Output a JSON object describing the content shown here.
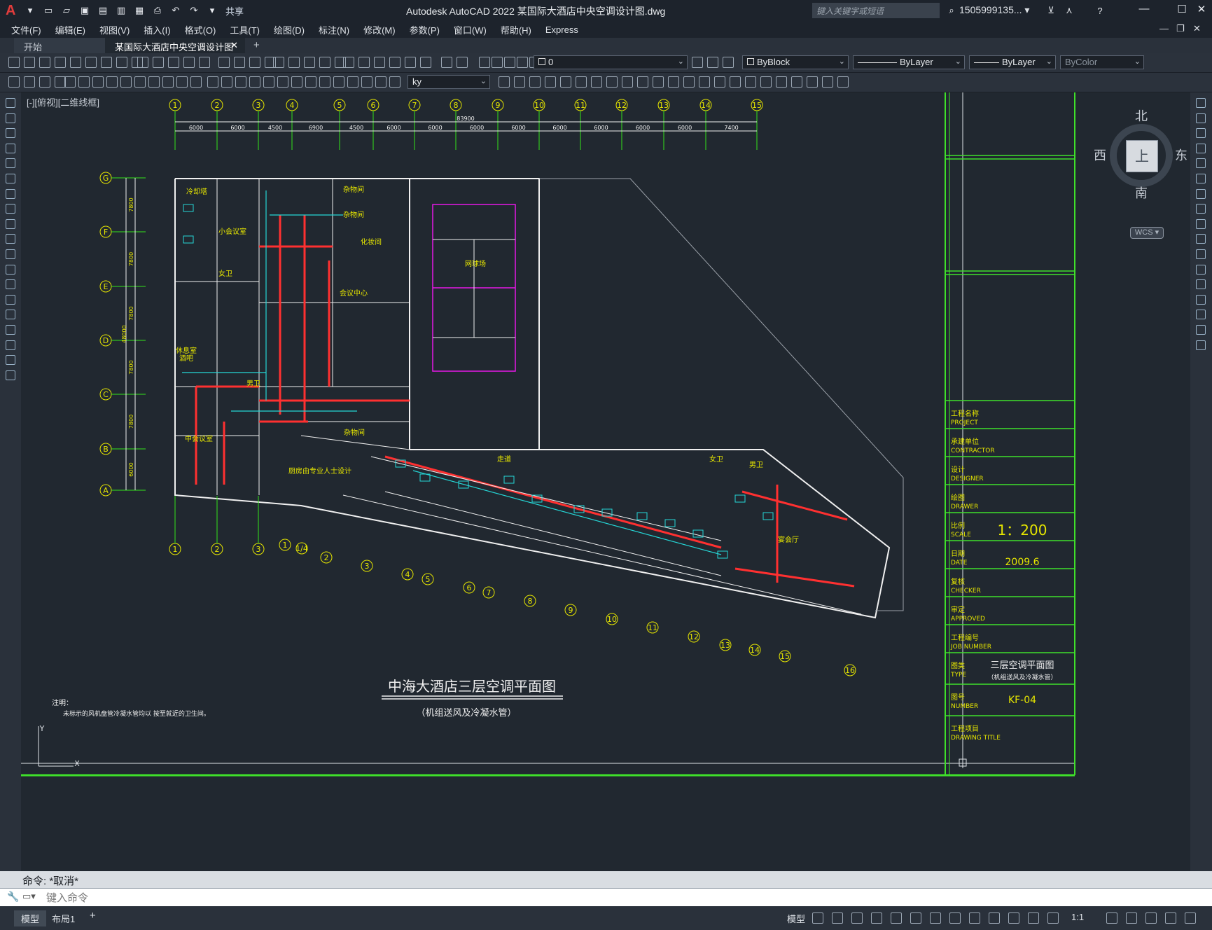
{
  "app": {
    "title": "Autodesk AutoCAD 2022    某国际大酒店中央空调设计图.dwg",
    "share_label": "共享",
    "search_placeholder": "键入关键字或短语",
    "user": "1505999135... ▾"
  },
  "menu": [
    "文件(F)",
    "编辑(E)",
    "视图(V)",
    "插入(I)",
    "格式(O)",
    "工具(T)",
    "绘图(D)",
    "标注(N)",
    "修改(M)",
    "参数(P)",
    "窗口(W)",
    "帮助(H)",
    "Express"
  ],
  "tabs": [
    {
      "label": "开始"
    },
    {
      "label": "某国际大酒店中央空调设计图*"
    }
  ],
  "properties": {
    "layer": "0",
    "color": "ByBlock",
    "linetype": "ByLayer",
    "lineweight": "ByLayer",
    "plotstyle": "ByColor",
    "dimstyle": "ky"
  },
  "viewport": {
    "label": "[-][俯视][二维线框]",
    "compass": {
      "north": "北",
      "south": "南",
      "east": "东",
      "west": "西",
      "top": "上"
    },
    "wcs": "WCS ▾"
  },
  "drawing": {
    "title": "中海大酒店三层空调平面图",
    "subtitle": "（机组送风及冷凝水管）",
    "note_title": "注明：",
    "note_text": "未标示的风机盘管冷凝水管均以  按至就近的卫生间。",
    "grid_top": [
      "1",
      "2",
      "3",
      "4",
      "5",
      "6",
      "7",
      "8",
      "9",
      "10",
      "11",
      "12",
      "13",
      "14",
      "15"
    ],
    "grid_left": [
      "G",
      "F",
      "E",
      "D",
      "C",
      "B",
      "A"
    ],
    "grid_bottom_a": [
      "1",
      "2",
      "3"
    ],
    "grid_bottom_b": [
      "1",
      "1/4",
      "2",
      "3",
      "4",
      "5",
      "6",
      "7",
      "8",
      "9",
      "10",
      "11",
      "12",
      "13",
      "14",
      "15",
      "16"
    ],
    "top_dims": [
      "6000",
      "6000",
      "4500",
      "6900",
      "4500",
      "6000",
      "6000",
      "6000",
      "6000",
      "6000",
      "6000",
      "6000",
      "6000",
      "7400"
    ],
    "overall_dim": "83900",
    "left_dims": [
      "7800",
      "7800",
      "7800",
      "7800",
      "7800",
      "6000"
    ],
    "left_total": "48000",
    "rooms": [
      "冷却塔",
      "小会议室",
      "杂物间",
      "杂物间",
      "化妆间",
      "女卫",
      "会议中心",
      "休息室",
      "酒吧",
      "男卫",
      "中会议室",
      "杂物间",
      "网球场",
      "走道",
      "女卫",
      "男卫",
      "宴会厅",
      "厨房由专业人士设计"
    ]
  },
  "title_block": {
    "project_label": "工程名称\nPROJECT",
    "contractor_label": "承建单位\nCONTRACTOR",
    "designer_label": "设计\nDESIGNER",
    "drawer_label": "绘图\nDRAWER",
    "scale_label": "比例\nSCALE",
    "scale": "1：200",
    "date_label": "日期\nDATE",
    "date": "2009.6",
    "checker_label": "复核\nCHECKER",
    "approved_label": "审定\nAPPROVED",
    "job_label": "工程编号\nJOB NUMBER",
    "type_label": "图类\nTYPE",
    "type_value": "三层空调平面图",
    "type_sub": "（机组送风及冷凝水管）",
    "number_label": "图号\nNUMBER",
    "number": "KF-04",
    "drawing_title_label": "工程项目\nDRAWING TITLE"
  },
  "command": {
    "history": "命令:  *取消*",
    "placeholder": "键入命令"
  },
  "status": {
    "layout_tabs": [
      "模型",
      "布局1"
    ],
    "model_label": "模型",
    "scale": "1:1"
  },
  "colors": {
    "background": "#212830",
    "grid_line": "#33e31a",
    "grid_bubble": "#e6e600",
    "wall": "#f0f0f0",
    "duct": "#ff3030",
    "cyan": "#25d7d7",
    "magenta": "#e619e6",
    "title_block": "#3fe02a",
    "title_text": "#e6e600"
  }
}
